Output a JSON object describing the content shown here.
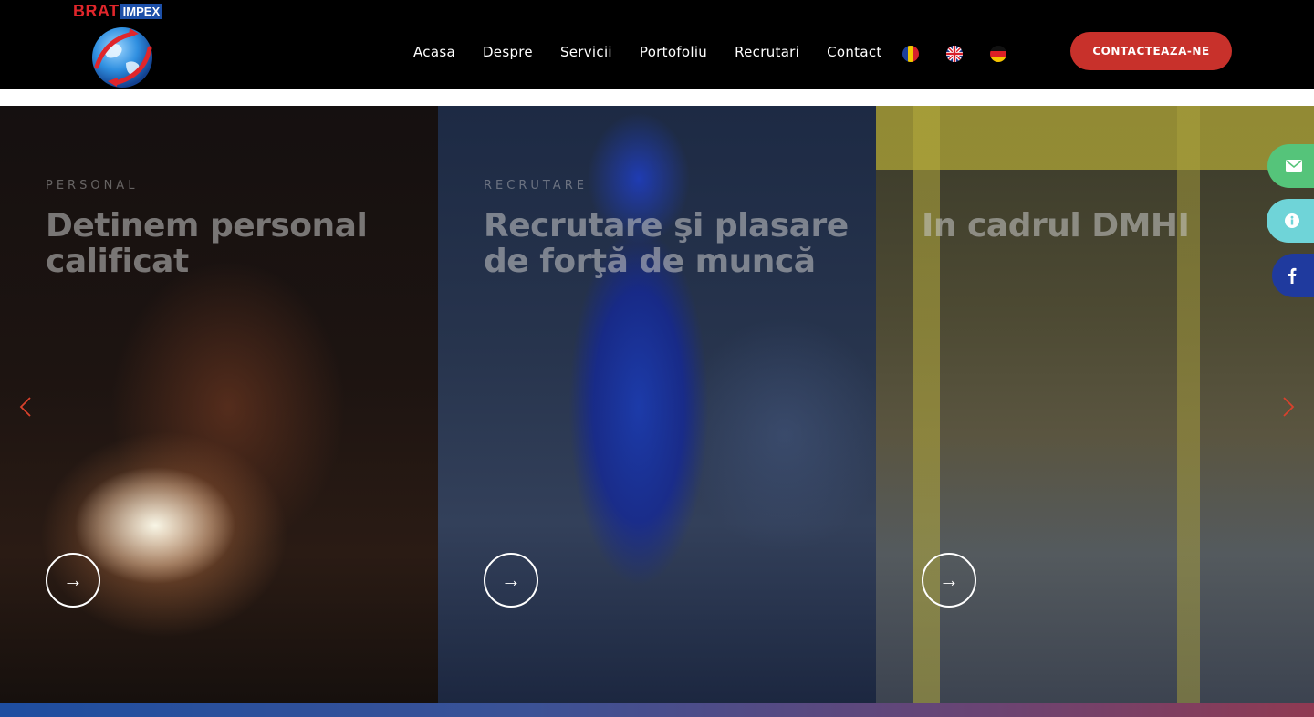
{
  "brand": {
    "name_main": "BRAT",
    "name_tag": "IMPEX"
  },
  "nav": {
    "items": [
      {
        "label": "Acasa"
      },
      {
        "label": "Despre"
      },
      {
        "label": "Servicii"
      },
      {
        "label": "Portofoliu"
      },
      {
        "label": "Recrutari"
      },
      {
        "label": "Contact"
      }
    ]
  },
  "languages": [
    {
      "icon": "flag-romania-icon"
    },
    {
      "icon": "flag-uk-icon"
    },
    {
      "icon": "flag-germany-icon"
    }
  ],
  "header": {
    "cta_label": "CONTACTEAZA-NE"
  },
  "slides": [
    {
      "eyebrow": "PERSONAL",
      "title": "Detinem personal calificat",
      "arrow": "→"
    },
    {
      "eyebrow": "RECRUTARE",
      "title": "Recrutare şi plasare de forţă de muncă",
      "arrow": "→"
    },
    {
      "eyebrow": "",
      "title": "In cadrul DMHI",
      "arrow": "→"
    }
  ],
  "slider_controls": {
    "prev_icon": "chevron-left-icon",
    "next_icon": "chevron-right-icon",
    "color": "#d9412c"
  },
  "floating_social": [
    {
      "icon": "envelope-icon",
      "color": "#55c47a"
    },
    {
      "icon": "info-icon",
      "color": "#6fd4d8"
    },
    {
      "icon": "facebook-icon",
      "color": "#1f3a9e"
    }
  ],
  "colors": {
    "header_bg": "#000000",
    "cta_bg": "#c8312b",
    "accent_red": "#e0262b",
    "accent_blue": "#1c4fa8"
  }
}
